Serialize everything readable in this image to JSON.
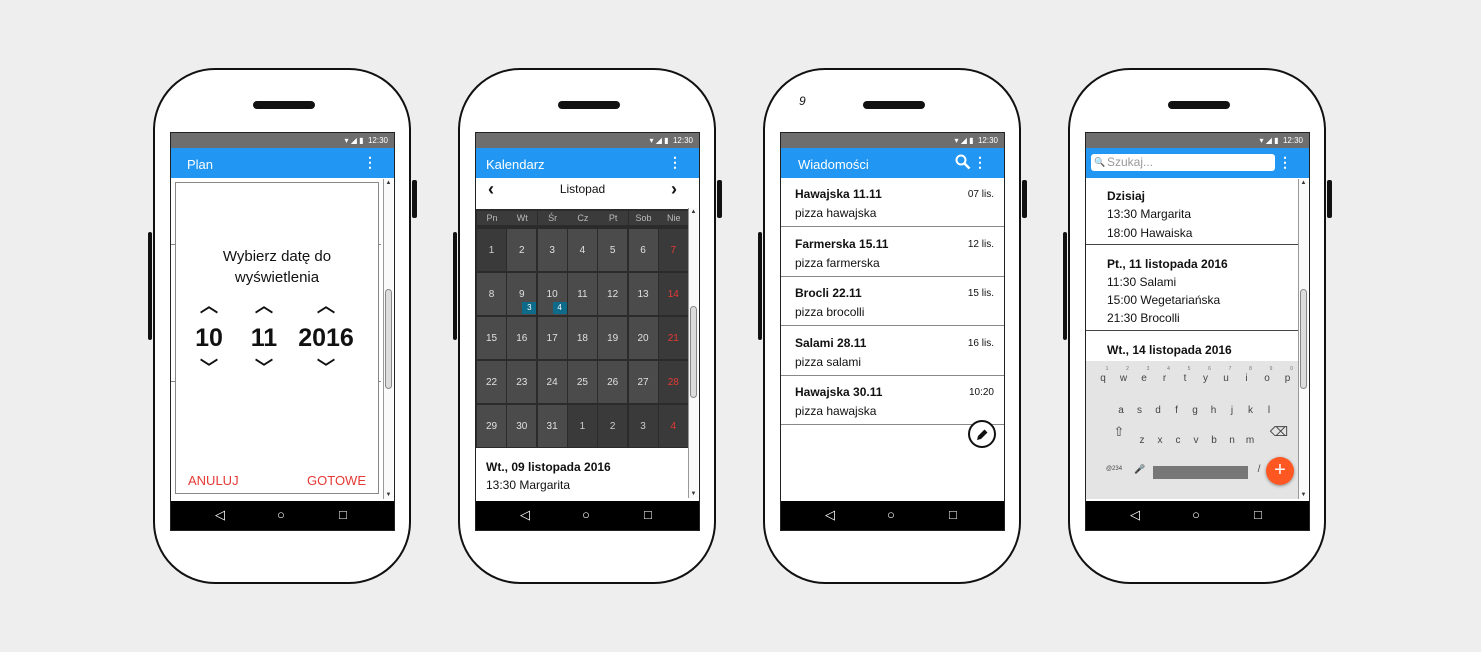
{
  "status": {
    "time": "12:30",
    "icons": "▾ ◢ ▮"
  },
  "nav": {
    "back": "◁",
    "home": "○",
    "recent": "□"
  },
  "menu_glyph": "⋮",
  "phone1": {
    "title": "Plan",
    "dialog": {
      "prompt_line1": "Wybierz datę do",
      "prompt_line2": "wyświetlenia",
      "day": "10",
      "month": "11",
      "year": "2016",
      "up": "^",
      "down": "v",
      "cancel": "ANULUJ",
      "ok": "GOTOWE"
    }
  },
  "phone2": {
    "title": "Kalendarz",
    "month": "Listopad",
    "prev": "‹",
    "next": "›",
    "weekdays": [
      "Pn",
      "Wt",
      "Śr",
      "Cz",
      "Pt",
      "Sob",
      "Nie"
    ],
    "weeks": [
      [
        "1",
        "2",
        "3",
        "4",
        "5",
        "6",
        "7"
      ],
      [
        "8",
        "9",
        "10",
        "11",
        "12",
        "13",
        "14"
      ],
      [
        "15",
        "16",
        "17",
        "18",
        "19",
        "20",
        "21"
      ],
      [
        "22",
        "23",
        "24",
        "25",
        "26",
        "27",
        "28"
      ],
      [
        "29",
        "30",
        "31",
        "1",
        "2",
        "3",
        "4"
      ]
    ],
    "badge_9": "3",
    "badge_10": "4",
    "info_title": "Wt., 09 listopada 2016",
    "info_line": "13:30 Margarita"
  },
  "phone3": {
    "corner_mark": "9",
    "title": "Wiadomości",
    "messages": [
      {
        "title": "Hawajska 11.11",
        "sub": "pizza hawajska",
        "date": "07 lis."
      },
      {
        "title": "Farmerska 15.11",
        "sub": "pizza farmerska",
        "date": "12 lis."
      },
      {
        "title": "Brocli 22.11",
        "sub": "pizza brocolli",
        "date": "15 lis."
      },
      {
        "title": "Salami 28.11",
        "sub": "pizza salami",
        "date": "16 lis."
      },
      {
        "title": "Hawajska 30.11",
        "sub": "pizza hawajska",
        "date": "10:20"
      }
    ]
  },
  "phone4": {
    "search_placeholder": "Szukaj...",
    "groups": [
      {
        "header": "Dzisiaj",
        "rows": [
          "13:30 Margarita",
          "18:00 Hawaiska"
        ]
      },
      {
        "header": "Pt., 11 listopada 2016",
        "rows": [
          "11:30 Salami",
          "15:00 Wegetariańska",
          "21:30 Brocolli"
        ]
      },
      {
        "header": "Wt., 14 listopada 2016",
        "rows": []
      }
    ],
    "keyboard": {
      "numbers": [
        "1",
        "2",
        "3",
        "4",
        "5",
        "6",
        "7",
        "8",
        "9",
        "0"
      ],
      "row1": [
        "q",
        "w",
        "e",
        "r",
        "t",
        "y",
        "u",
        "i",
        "o",
        "p"
      ],
      "row2": [
        "a",
        "s",
        "d",
        "f",
        "g",
        "h",
        "j",
        "k",
        "l"
      ],
      "row3": [
        "z",
        "x",
        "c",
        "v",
        "b",
        "n",
        "m"
      ],
      "symbols": "@234",
      "slash": "/",
      "shift": "⇧",
      "backspace": "⌫",
      "mic": "🎤"
    },
    "fab": "+"
  }
}
